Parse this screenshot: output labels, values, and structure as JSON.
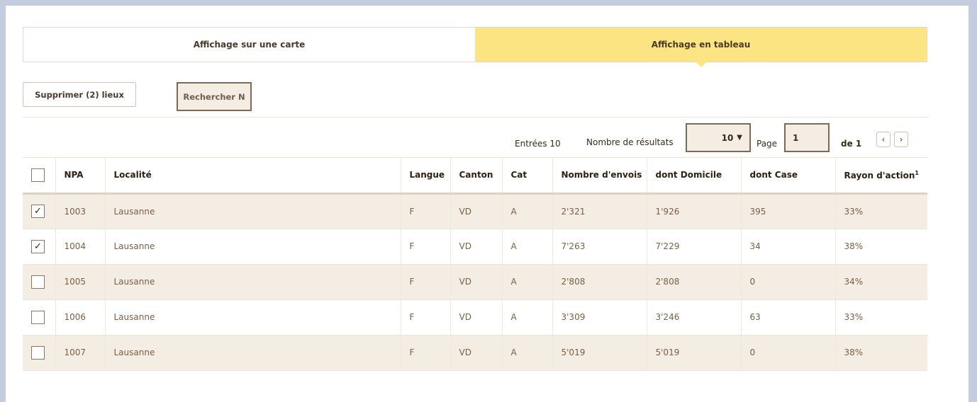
{
  "tabs": [
    {
      "label": "Affichage sur une carte",
      "active": false
    },
    {
      "label": "Affichage en tableau",
      "active": true
    }
  ],
  "actions": {
    "delete_label": "Supprimer (2) lieux",
    "search_label": "Rechercher N"
  },
  "pager": {
    "entries_label": "Entrées 10",
    "results_label": "Nombre de résultats",
    "results_value": "10",
    "results_caret": "▼",
    "page_label": "Page",
    "page_value": "1",
    "of_label": "de 1",
    "prev_glyph": "‹",
    "next_glyph": "›"
  },
  "table": {
    "headers": {
      "npa": "NPA",
      "localite": "Localité",
      "langue": "Langue",
      "canton": "Canton",
      "cat": "Cat",
      "envois": "Nombre d'envois",
      "domicile": "dont Domicile",
      "case": "dont Case",
      "rayon": "Rayon d'action",
      "rayon_sup": "1"
    },
    "rows": [
      {
        "checked": true,
        "npa": "1003",
        "localite": "Lausanne",
        "langue": "F",
        "canton": "VD",
        "cat": "A",
        "envois": "2'321",
        "domicile": "1'926",
        "case": "395",
        "rayon": "33%"
      },
      {
        "checked": true,
        "npa": "1004",
        "localite": "Lausanne",
        "langue": "F",
        "canton": "VD",
        "cat": "A",
        "envois": "7'263",
        "domicile": "7'229",
        "case": "34",
        "rayon": "38%"
      },
      {
        "checked": false,
        "npa": "1005",
        "localite": "Lausanne",
        "langue": "F",
        "canton": "VD",
        "cat": "A",
        "envois": "2'808",
        "domicile": "2'808",
        "case": "0",
        "rayon": "34%"
      },
      {
        "checked": false,
        "npa": "1006",
        "localite": "Lausanne",
        "langue": "F",
        "canton": "VD",
        "cat": "A",
        "envois": "3'309",
        "domicile": "3'246",
        "case": "63",
        "rayon": "33%"
      },
      {
        "checked": false,
        "npa": "1007",
        "localite": "Lausanne",
        "langue": "F",
        "canton": "VD",
        "cat": "A",
        "envois": "5'019",
        "domicile": "5'019",
        "case": "0",
        "rayon": "38%"
      }
    ]
  },
  "checkbox": {
    "checked_glyph": "✓"
  },
  "colors": {
    "active_tab": "#fde482",
    "row_alt": "#f3ede4",
    "outer_border": "#c3cddf",
    "text": "#4a3a2a"
  }
}
